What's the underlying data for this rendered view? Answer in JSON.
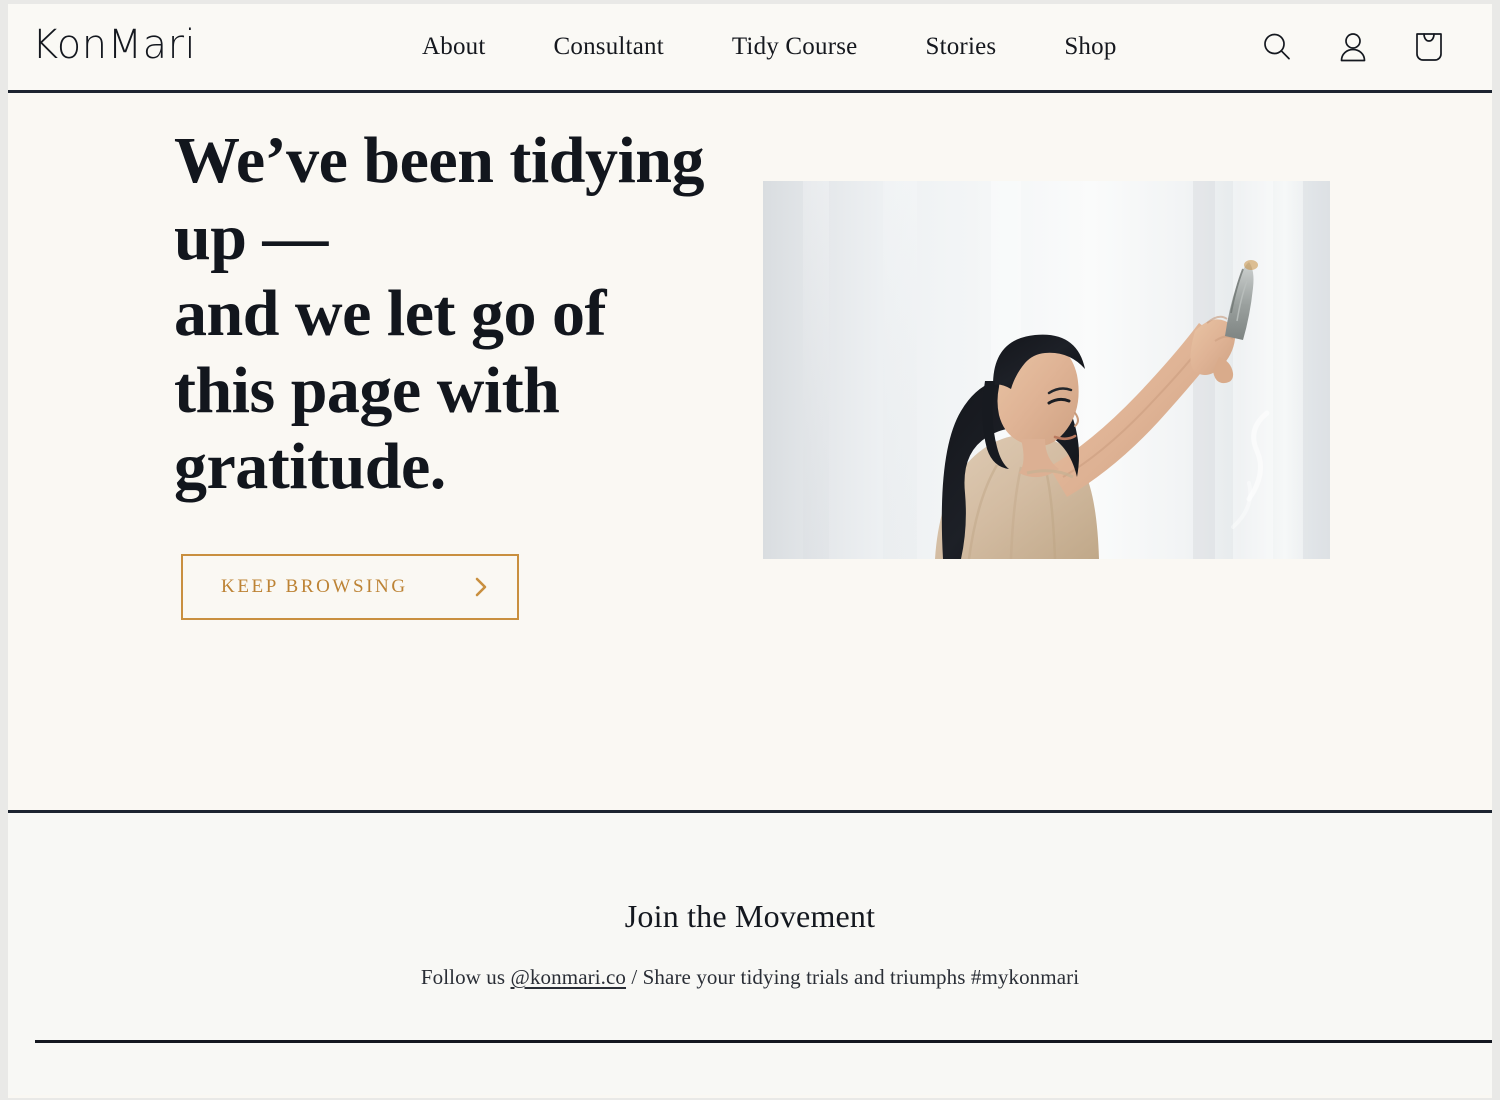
{
  "site": {
    "brand": "KonMari",
    "background_hero": "#FAF8F3",
    "background_footer": "#F8F8F5",
    "accent_gold": "#C98F3F",
    "ink": "#14181F"
  },
  "header": {
    "logo_label": "KonMari",
    "nav": [
      {
        "label": "About"
      },
      {
        "label": "Consultant"
      },
      {
        "label": "Tidy Course"
      },
      {
        "label": "Stories"
      },
      {
        "label": "Shop"
      }
    ],
    "icons": [
      {
        "name": "search-icon",
        "label": "Search"
      },
      {
        "name": "account-icon",
        "label": "Account"
      },
      {
        "name": "shopping-bag-icon",
        "label": "Cart"
      }
    ]
  },
  "hero": {
    "headline_lines": [
      "We’ve been tidying",
      "up —",
      "and we let go of",
      "this page with",
      "gratitude."
    ],
    "cta": {
      "label": "KEEP BROWSING",
      "arrow": "chevron-right-icon"
    },
    "image": {
      "alt": "Woman with long dark hair raising a sage smudge stick toward a bright white curtain"
    }
  },
  "footer": {
    "title": "Join the Movement",
    "follow_prefix": "Follow us ",
    "handle": "@konmari.co",
    "follow_suffix": " / Share your tidying trials and triumphs #mykonmari"
  }
}
